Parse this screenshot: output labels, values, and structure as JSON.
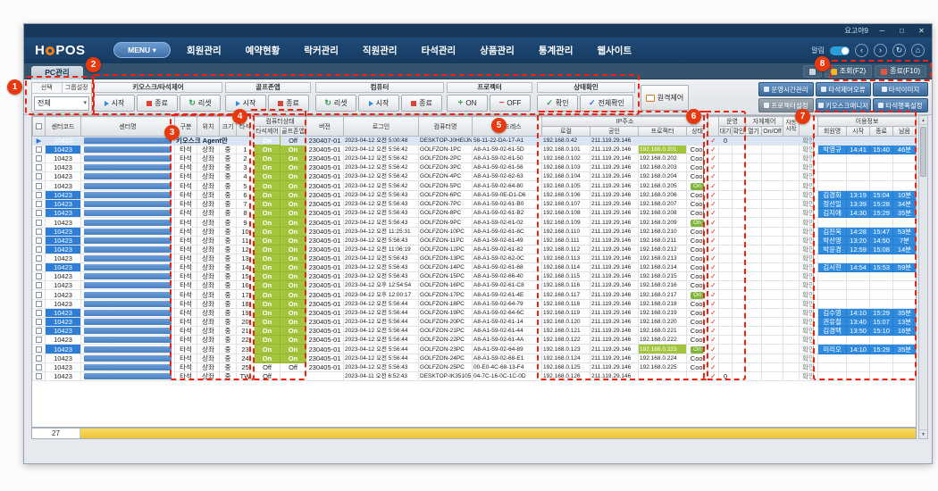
{
  "window": {
    "account": "요고야9",
    "minimize": "─",
    "maximize": "□",
    "close": "✕"
  },
  "nav": {
    "logo_h": "H",
    "logo_pos": "POS",
    "menu": "MENU",
    "menu_caret": "▾",
    "items": [
      "회원관리",
      "예약현황",
      "락커관리",
      "직원관리",
      "타석관리",
      "상품관리",
      "통계관리",
      "웹사이트"
    ],
    "alarm": "알림",
    "nav_icons": [
      "‹",
      "›",
      "↻",
      "⌂"
    ]
  },
  "tab": {
    "active": "PC관리"
  },
  "top_actions": {
    "query": "조회(F2)",
    "exit": "종료(F10)"
  },
  "toolbar": {
    "select": {
      "label1": "선택",
      "label2": "그룹설정",
      "value": "전체"
    },
    "groups": [
      {
        "label": "키오스크/타석제어",
        "buttons": [
          "시작",
          "종료",
          "리셋"
        ]
      },
      {
        "label": "골프존앱",
        "buttons": [
          "시작",
          "종료"
        ]
      },
      {
        "label": "컴퓨터",
        "buttons": [
          "리셋",
          "시작",
          "종료"
        ]
      },
      {
        "label": "프로젝터",
        "buttons": [
          "ON",
          "OFF"
        ]
      },
      {
        "label": "상태확인",
        "buttons": [
          "확인",
          "전체확인"
        ]
      }
    ],
    "remote": "원격제어",
    "right1": [
      "운영시간관리",
      "타석제어오류",
      "타석이미지"
    ],
    "right2": [
      "프로젝터설정",
      "키오스크매니저",
      "타석행폭설정"
    ]
  },
  "table": {
    "cols": {
      "code": "센터코드",
      "name": "센터명",
      "gubun": "구분",
      "wichi": "위치",
      "size": "크기",
      "taseok": "타석",
      "grp_pc": "컴퓨터상태",
      "tc": "타석제어",
      "ga": "골프존앱",
      "ver": "버전",
      "login": "로그인",
      "pc": "컴퓨터명",
      "mac": "맥어드레스",
      "grp_ip": "IP주소",
      "ipl": "로컬",
      "ipp": "공인",
      "ippj": "프로젝터",
      "st": "상태",
      "grp_op": "운영",
      "wait": "대기",
      "conf": "확인",
      "grp_self": "자체제어",
      "open": "열기",
      "onoff": "On/Off",
      "auto": "자동시작",
      "grp_use": "이용정보",
      "member": "회원명",
      "start": "시작",
      "end": "종료",
      "remain": "남음"
    },
    "rows": [
      {
        "sel": 1,
        "mk": "▶",
        "code": "10423",
        "kiosk": "키오스크 Agent만",
        "tc": "On",
        "ga": "Off",
        "ver": "230407-01",
        "lg": "2023-04-12 오전 5:00:48",
        "pc": "DESKTOP-J0HEIJN",
        "mac": "58-11-22-DA-17-A1",
        "ip": "192.168.0.42",
        "pub": "211.119.29.146",
        "pj": "",
        "st": "",
        "ck": 1,
        "wt": "0",
        "cf": "확인",
        "use": null
      },
      {
        "sel": 1,
        "code": "10423",
        "gb": "타석",
        "wc": "상좌",
        "sz": "중",
        "no": "1",
        "tc": "On",
        "ga": "On",
        "ver": "230405-01",
        "lg": "2023-04-12 오전 5:56:42",
        "pc": "GOLFZON-1PC",
        "mac": "A8-A1-59-02-61-5D",
        "ip": "192.168.0.101",
        "pub": "211.119.29.146",
        "pj": "192.168.0.201",
        "pjhl": 1,
        "st": "Cool",
        "ck": 1,
        "cf": "확인",
        "use": {
          "nm": "박영규",
          "s": "14:41",
          "e": "15:40",
          "r": "46분"
        }
      },
      {
        "code": "10423",
        "gb": "타석",
        "wc": "상좌",
        "sz": "중",
        "no": "2",
        "tc": "On",
        "ga": "On",
        "ver": "230405-01",
        "lg": "2023-04-12 오전 5:56:42",
        "pc": "GOLFZON-2PC",
        "mac": "A8-A1-59-02-61-50",
        "ip": "192.168.0.102",
        "pub": "211.119.29.146",
        "pj": "192.168.0.202",
        "st": "Cool",
        "ck": 1,
        "cf": "확인",
        "use": null
      },
      {
        "code": "10423",
        "gb": "타석",
        "wc": "상좌",
        "sz": "중",
        "no": "3",
        "tc": "On",
        "ga": "On",
        "ver": "230405-01",
        "lg": "2023-04-12 오전 5:56:42",
        "pc": "GOLFZON-3PC",
        "mac": "A8-A1-59-02-61-56",
        "ip": "192.168.0.103",
        "pub": "211.119.29.146",
        "pj": "192.168.0.203",
        "st": "Cool",
        "ck": 1,
        "cf": "확인",
        "use": null
      },
      {
        "code": "10423",
        "gb": "타석",
        "wc": "상좌",
        "sz": "중",
        "no": "4",
        "tc": "On",
        "ga": "On",
        "ver": "230405-01",
        "lg": "2023-04-12 오전 5:56:42",
        "pc": "GOLFZON-4PC",
        "mac": "A8-A1-59-02-62-63",
        "ip": "192.168.0.104",
        "pub": "211.119.29.146",
        "pj": "192.168.0.204",
        "st": "Cool",
        "ck": 1,
        "cf": "확인",
        "use": null
      },
      {
        "code": "10423",
        "gb": "타석",
        "wc": "상좌",
        "sz": "중",
        "no": "5",
        "tc": "On",
        "ga": "On",
        "ver": "230405-01",
        "lg": "2023-04-12 오전 5:56:42",
        "pc": "GOLFZON-5PC",
        "mac": "A8-A1-59-02-64-80",
        "ip": "192.168.0.105",
        "pub": "211.119.29.146",
        "pj": "192.168.0.205",
        "st": "On",
        "ck": 1,
        "cf": "확인",
        "use": null
      },
      {
        "sel": 1,
        "code": "10423",
        "gb": "타석",
        "wc": "상좌",
        "sz": "중",
        "no": "6",
        "tc": "On",
        "ga": "On",
        "ver": "230405-01",
        "lg": "2023-04-12 오전 5:56:43",
        "pc": "GOLFZON-6PC",
        "mac": "A8-A1-59-0E-D1-D6",
        "ip": "192.168.0.106",
        "pub": "211.119.29.146",
        "pj": "192.168.0.206",
        "st": "Cool",
        "ck": 1,
        "cf": "확인",
        "use": {
          "nm": "김경화",
          "s": "13:19",
          "e": "15:04",
          "r": "10분"
        }
      },
      {
        "sel": 1,
        "code": "10423",
        "gb": "타석",
        "wc": "상좌",
        "sz": "중",
        "no": "7",
        "tc": "On",
        "ga": "On",
        "ver": "230405-01",
        "lg": "2023-04-12 오전 5:56:43",
        "pc": "GOLFZON-7PC",
        "mac": "A8-A1-59-02-61-B0",
        "ip": "192.168.0.107",
        "pub": "211.119.29.146",
        "pj": "192.168.0.207",
        "st": "Cool",
        "ck": 1,
        "cf": "확인",
        "use": {
          "nm": "정선일",
          "s": "13:39",
          "e": "15:28",
          "r": "34분"
        }
      },
      {
        "sel": 1,
        "code": "10423",
        "gb": "타석",
        "wc": "상좌",
        "sz": "중",
        "no": "8",
        "tc": "On",
        "ga": "On",
        "ver": "230405-01",
        "lg": "2023-04-12 오전 5:56:43",
        "pc": "GOLFZON-8PC",
        "mac": "A8-A1-59-02-61-B2",
        "ip": "192.168.0.108",
        "pub": "211.119.29.146",
        "pj": "192.168.0.208",
        "st": "Cool",
        "ck": 1,
        "cf": "확인",
        "use": {
          "nm": "김지애",
          "s": "14:30",
          "e": "15:29",
          "r": "35분"
        }
      },
      {
        "code": "10423",
        "gb": "타석",
        "wc": "상좌",
        "sz": "중",
        "no": "9",
        "tc": "On",
        "ga": "On",
        "ver": "230405-01",
        "lg": "2023-04-12 오전 5:56:43",
        "pc": "GOLFZON-9PC",
        "mac": "A8-A1-59-02-61-02",
        "ip": "192.168.0.109",
        "pub": "211.119.29.146",
        "pj": "192.168.0.209",
        "st": "On",
        "ck": 1,
        "cf": "확인",
        "use": null
      },
      {
        "sel": 1,
        "code": "10423",
        "gb": "타석",
        "wc": "상좌",
        "sz": "중",
        "no": "10",
        "tc": "On",
        "ga": "On",
        "ver": "230405-01",
        "lg": "2023-04-12 오전 11:25:31",
        "pc": "GOLFZON-10PC",
        "mac": "A8-A1-59-02-61-8C",
        "ip": "192.168.0.110",
        "pub": "211.119.29.146",
        "pj": "192.168.0.210",
        "st": "Cool",
        "ck": 1,
        "cf": "확인",
        "use": {
          "nm": "김진욱",
          "s": "14:28",
          "e": "15:47",
          "r": "53분"
        }
      },
      {
        "sel": 1,
        "code": "10423",
        "gb": "타석",
        "wc": "상좌",
        "sz": "중",
        "no": "11",
        "tc": "On",
        "ga": "On",
        "ver": "230405-01",
        "lg": "2023-04-12 오전 5:56:43",
        "pc": "GOLFZON-11PC",
        "mac": "A8-A1-59-02-61-49",
        "ip": "192.168.0.111",
        "pub": "211.119.29.146",
        "pj": "192.168.0.211",
        "st": "Cool",
        "ck": 1,
        "cf": "확인",
        "use": {
          "nm": "박선영",
          "s": "13:20",
          "e": "14:50",
          "r": "7분"
        }
      },
      {
        "sel": 1,
        "code": "10423",
        "gb": "타석",
        "wc": "상좌",
        "sz": "중",
        "no": "12",
        "tc": "On",
        "ga": "On",
        "ver": "230405-01",
        "lg": "2023-04-12 오전 11:06:19",
        "pc": "GOLFZON-12PC",
        "mac": "A8-A1-59-02-61-82",
        "ip": "192.168.0.112",
        "pub": "211.119.29.146",
        "pj": "192.168.0.212",
        "st": "Cool",
        "ck": 1,
        "cf": "확인",
        "use": {
          "nm": "박윤경",
          "s": "12:59",
          "e": "15:08",
          "r": "14분"
        }
      },
      {
        "code": "10423",
        "gb": "타석",
        "wc": "상좌",
        "sz": "중",
        "no": "13",
        "tc": "On",
        "ga": "On",
        "ver": "230405-01",
        "lg": "2023-04-12 오전 5:56:43",
        "pc": "GOLFZON-13PC",
        "mac": "A8-A1-59-02-62-0C",
        "ip": "192.168.0.113",
        "pub": "211.119.29.146",
        "pj": "192.168.0.213",
        "st": "Cool",
        "ck": 1,
        "cf": "확인",
        "use": null
      },
      {
        "sel": 1,
        "code": "10423",
        "gb": "타석",
        "wc": "상좌",
        "sz": "중",
        "no": "14",
        "tc": "On",
        "ga": "On",
        "ver": "230405-01",
        "lg": "2023-04-12 오전 5:56:43",
        "pc": "GOLFZON-14PC",
        "mac": "A8-A1-59-02-61-68",
        "ip": "192.168.0.114",
        "pub": "211.119.29.146",
        "pj": "192.168.0.214",
        "st": "Cool",
        "ck": 1,
        "cf": "확인",
        "use": {
          "nm": "김시현",
          "s": "14:54",
          "e": "15:53",
          "r": "59분"
        }
      },
      {
        "code": "10423",
        "gb": "타석",
        "wc": "상좌",
        "sz": "중",
        "no": "15",
        "tc": "On",
        "ga": "On",
        "ver": "230405-01",
        "lg": "2023-04-12 오전 5:56:43",
        "pc": "GOLFZON-15PC",
        "mac": "A8-A1-59-02-66-40",
        "ip": "192.168.0.115",
        "pub": "211.119.29.146",
        "pj": "192.168.0.215",
        "st": "Cool",
        "ck": 1,
        "cf": "확인",
        "use": null
      },
      {
        "code": "10423",
        "gb": "타석",
        "wc": "상좌",
        "sz": "중",
        "no": "16",
        "tc": "On",
        "ga": "On",
        "ver": "230405-01",
        "lg": "2023-04-12 오후 12:54:54",
        "pc": "GOLFZON-16PC",
        "mac": "A8-A1-59-02-61-C8",
        "ip": "192.168.0.116",
        "pub": "211.119.29.146",
        "pj": "192.168.0.216",
        "st": "Cool",
        "ck": 1,
        "cf": "확인",
        "use": null
      },
      {
        "code": "10423",
        "gb": "타석",
        "wc": "상좌",
        "sz": "중",
        "no": "17",
        "tc": "On",
        "ga": "On",
        "ver": "230405-01",
        "lg": "2023-04-12 오후 12:00:17",
        "pc": "GOLFZON-17PC",
        "mac": "A8-A1-59-02-61-4E",
        "ip": "192.168.0.117",
        "pub": "211.119.29.146",
        "pj": "192.168.0.217",
        "st": "On",
        "ck": 1,
        "cf": "확인",
        "use": null
      },
      {
        "code": "10423",
        "gb": "타석",
        "wc": "상좌",
        "sz": "중",
        "no": "18",
        "tc": "On",
        "ga": "On",
        "ver": "230405-01",
        "lg": "2023-04-12 오전 5:56:44",
        "pc": "GOLFZON-18PC",
        "mac": "A8-A1-59-02-64-79",
        "ip": "192.168.0.118",
        "pub": "211.119.29.146",
        "pj": "192.168.0.218",
        "st": "Cool",
        "ck": 1,
        "cf": "확인",
        "use": null
      },
      {
        "sel": 1,
        "code": "10423",
        "gb": "타석",
        "wc": "상좌",
        "sz": "중",
        "no": "19",
        "tc": "On",
        "ga": "On",
        "ver": "230405-01",
        "lg": "2023-04-12 오전 5:56:44",
        "pc": "GOLFZON-19PC",
        "mac": "A8-A1-59-02-64-6C",
        "ip": "192.168.0.119",
        "pub": "211.119.29.146",
        "pj": "192.168.0.219",
        "st": "Cool",
        "ck": 1,
        "cf": "확인",
        "use": {
          "nm": "김수영",
          "s": "14:10",
          "e": "15:29",
          "r": "35분"
        }
      },
      {
        "sel": 1,
        "code": "10423",
        "gb": "타석",
        "wc": "상좌",
        "sz": "중",
        "no": "20",
        "tc": "On",
        "ga": "On",
        "ver": "230405-01",
        "lg": "2023-04-12 오전 5:56:44",
        "pc": "GOLFZON-20PC",
        "mac": "A8-A1-59-02-61-14",
        "ip": "192.168.0.120",
        "pub": "211.119.29.146",
        "pj": "192.168.0.220",
        "st": "Cool",
        "ck": 1,
        "cf": "확인",
        "use": {
          "nm": "권유철",
          "s": "13:40",
          "e": "15:07",
          "r": "13분"
        }
      },
      {
        "sel": 1,
        "code": "10423",
        "gb": "타석",
        "wc": "상좌",
        "sz": "중",
        "no": "21",
        "tc": "On",
        "ga": "On",
        "ver": "230405-01",
        "lg": "2023-04-12 오전 5:56:44",
        "pc": "GOLFZON-21PC",
        "mac": "A8-A1-59-02-61-44",
        "ip": "192.168.0.121",
        "pub": "211.119.29.146",
        "pj": "192.168.0.221",
        "st": "Cool",
        "ck": 1,
        "cf": "확인",
        "use": {
          "nm": "김경택",
          "s": "13:50",
          "e": "15:10",
          "r": "16분"
        }
      },
      {
        "code": "10423",
        "gb": "타석",
        "wc": "상좌",
        "sz": "중",
        "no": "22",
        "tc": "On",
        "ga": "On",
        "ver": "230405-01",
        "lg": "2023-04-12 오전 5:56:44",
        "pc": "GOLFZON-22PC",
        "mac": "A8-A1-59-02-61-4A",
        "ip": "192.168.0.122",
        "pub": "211.119.29.146",
        "pj": "192.168.0.222",
        "st": "Cool",
        "ck": 1,
        "cf": "확인",
        "use": null
      },
      {
        "sel": 1,
        "code": "10423",
        "gb": "타석",
        "wc": "상좌",
        "sz": "중",
        "no": "23",
        "tc": "On",
        "ga": "On",
        "ver": "230405-01",
        "lg": "2023-04-12 오전 5:56:44",
        "pc": "GOLFZON-23PC",
        "mac": "A8-A1-59-02-64-89",
        "ip": "192.168.0.123",
        "pub": "211.119.29.146",
        "pj": "192.168.0.223",
        "pjhl": 1,
        "st": "On",
        "ck": 1,
        "cf": "확인",
        "use": {
          "nm": "미리오",
          "s": "14:10",
          "e": "15:29",
          "r": "35분"
        }
      },
      {
        "code": "10423",
        "gb": "타석",
        "wc": "상좌",
        "sz": "중",
        "no": "24",
        "tc": "On",
        "ga": "On",
        "ver": "230405-01",
        "lg": "2023-04-12 오전 5:56:44",
        "pc": "GOLFZON-24PC",
        "mac": "A8-A1-59-02-68-E1",
        "ip": "192.168.0.124",
        "pub": "211.119.29.146",
        "pj": "192.168.0.224",
        "st": "Cool",
        "ck": 1,
        "cf": "확인",
        "use": null
      },
      {
        "code": "10423",
        "gb": "타석",
        "wc": "상좌",
        "sz": "중",
        "no": "25",
        "tc": "Off",
        "ga": "Off",
        "ver": "230405-01",
        "lg": "2023-04-12 오전 5:56:43",
        "pc": "GOLFZON-25PC",
        "mac": "00-E0-4C-68-13-F4",
        "ip": "192.168.0.125",
        "pub": "211.119.29.146",
        "pj": "192.168.0.225",
        "st": "Cool",
        "ck": 1,
        "cf": "확인",
        "use": null
      },
      {
        "code": "10423",
        "gb": "타석",
        "wc": "상좌",
        "sz": "중",
        "no": "TW",
        "tc": "Off",
        "ga": "",
        "ver": "",
        "lg": "2023-04-11 오전 6:52:43",
        "pc": "DESKTOP-IK35105",
        "mac": "04-7C-16-0C-1C-0D",
        "ip": "192.168.0.126",
        "pub": "211.119.29.146",
        "pj": "",
        "st": "",
        "ck": 1,
        "wt": "0",
        "cf": "확인",
        "use": null
      }
    ]
  },
  "footer": {
    "count": "27"
  },
  "annotations": [
    "1",
    "2",
    "3",
    "4",
    "5",
    "6",
    "7",
    "8"
  ]
}
